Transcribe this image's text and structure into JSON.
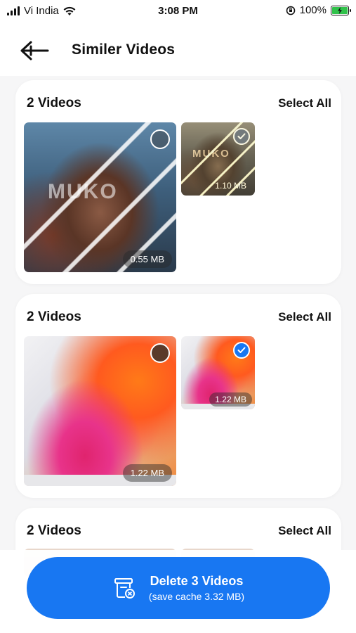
{
  "status": {
    "carrier": "Vi India",
    "time": "3:08 PM",
    "battery": "100%"
  },
  "header": {
    "title": "Similer Videos",
    "back_icon": "arrow-left-icon"
  },
  "groups": [
    {
      "count_label": "2  Videos",
      "select_all": "Select All",
      "watermark": "MUKO",
      "videos": [
        {
          "size": "0.55 MB",
          "selected": false
        },
        {
          "size": "1.10 MB",
          "selected": true
        }
      ]
    },
    {
      "count_label": "2  Videos",
      "select_all": "Select All",
      "videos": [
        {
          "size": "1.22 MB",
          "selected": false
        },
        {
          "size": "1.22 MB",
          "selected": true
        }
      ]
    },
    {
      "count_label": "2  Videos",
      "select_all": "Select All"
    }
  ],
  "delete_button": {
    "title": "Delete 3 Videos",
    "subtitle": "(save cache 3.32 MB)",
    "icon": "trash-icon"
  },
  "colors": {
    "accent": "#1877f2",
    "battery": "#30c24a"
  }
}
